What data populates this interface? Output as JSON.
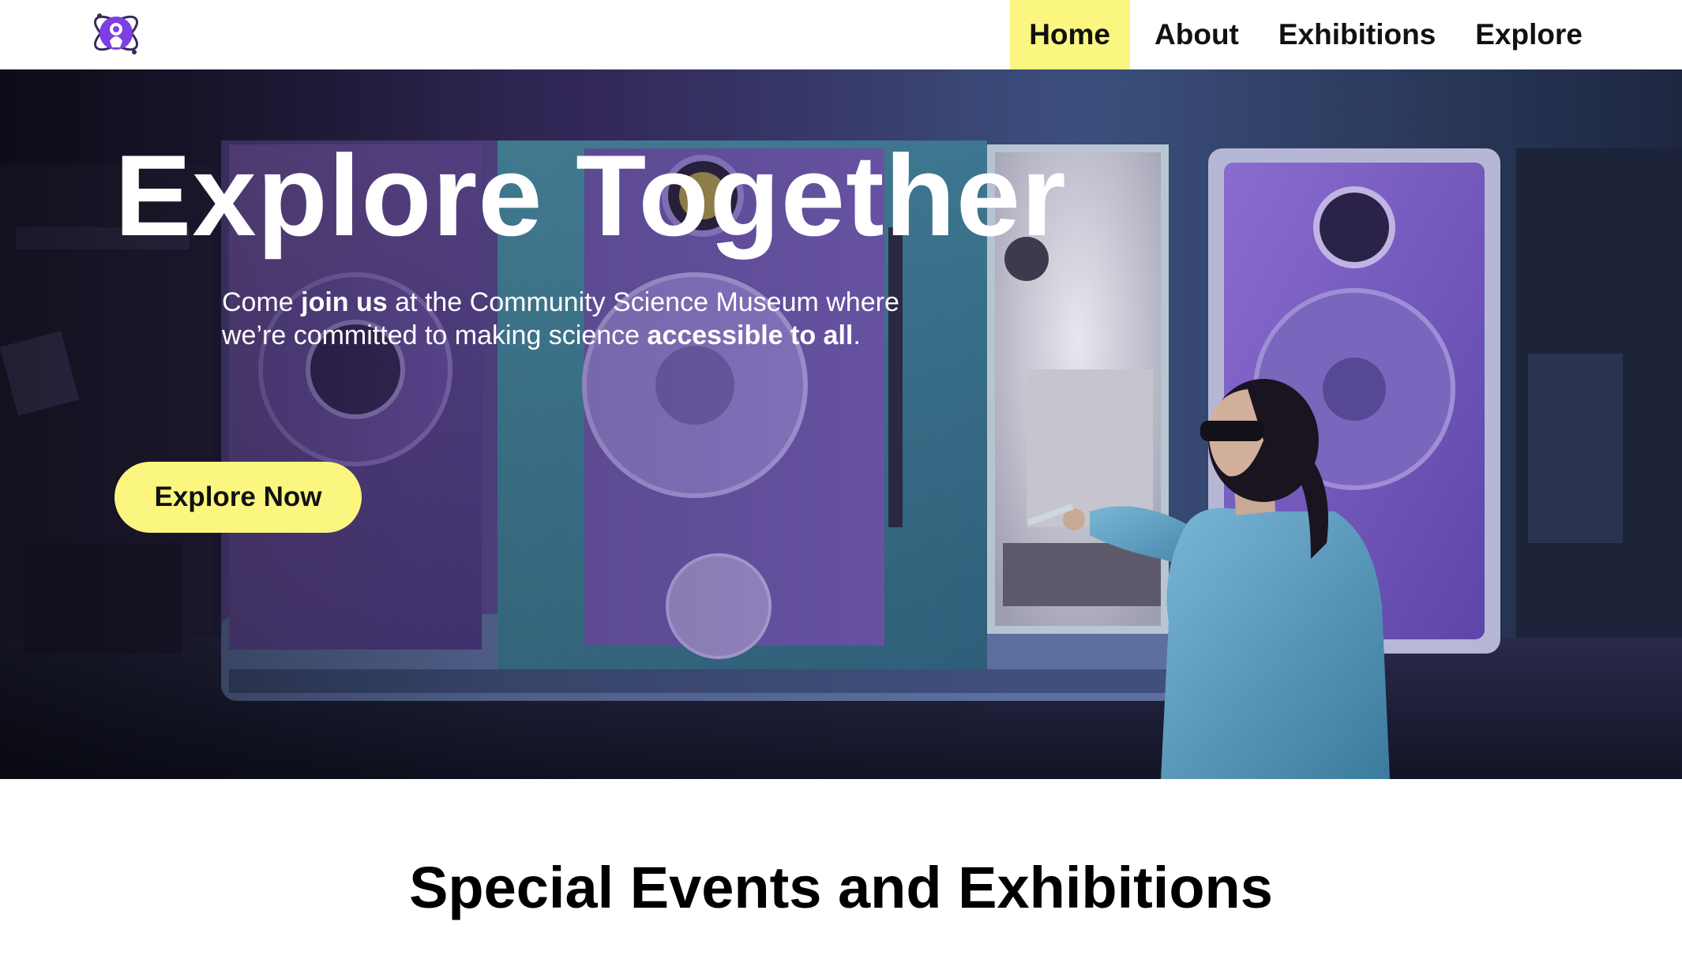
{
  "nav": {
    "logo_icon": "atom-logo-icon",
    "links": [
      {
        "label": "Home",
        "active": true
      },
      {
        "label": "About",
        "active": false
      },
      {
        "label": "Exhibitions",
        "active": false
      },
      {
        "label": "Explore",
        "active": false
      }
    ]
  },
  "hero": {
    "title": "Explore Together",
    "text_parts": {
      "p1": "Come ",
      "b1": "join us",
      "p2": " at the Community Science Museum where we’re committed to making science ",
      "b2": "accessible to all",
      "p3": "."
    },
    "cta_label": "Explore Now",
    "background_description_icon": "laboratory-photo"
  },
  "section": {
    "title": "Special Events and Exhibitions"
  },
  "colors": {
    "accent_yellow": "#fbf67f",
    "brand_purple": "#7b3fe4",
    "text_dark": "#111111",
    "text_light": "#ffffff"
  }
}
